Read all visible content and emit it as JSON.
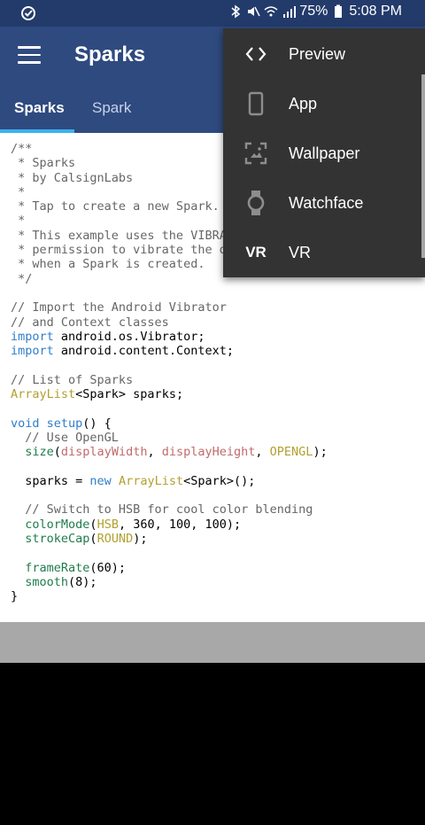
{
  "status_bar": {
    "battery": "75%",
    "time": "5:08 PM"
  },
  "app_bar": {
    "title": "Sparks",
    "tabs": [
      {
        "label": "Sparks",
        "selected": true
      },
      {
        "label": "Spark",
        "selected": false
      }
    ]
  },
  "menu": {
    "items": [
      {
        "label": "Preview",
        "icon": "code-icon"
      },
      {
        "label": "App",
        "icon": "phone-icon"
      },
      {
        "label": "Wallpaper",
        "icon": "wallpaper-icon"
      },
      {
        "label": "Watchface",
        "icon": "watch-icon"
      },
      {
        "label": "VR",
        "icon": "vr-icon",
        "icon_text": "VR"
      }
    ]
  },
  "code": {
    "lines": [
      "/**",
      " * Sparks",
      " * by CalsignLabs",
      " *",
      " * Tap to create a new Spark.",
      " *",
      " * This example uses the VIBRATE",
      " * permission to vibrate the device",
      " * when a Spark is created.",
      " */",
      "",
      "// Import the Android Vibrator",
      "// and Context classes",
      "import android.os.Vibrator;",
      "import android.content.Context;",
      "",
      "// List of Sparks",
      "ArrayList<Spark> sparks;",
      "",
      "void setup() {",
      "  // Use OpenGL",
      "  size(displayWidth, displayHeight, OPENGL);",
      "",
      "  sparks = new ArrayList<Spark>();",
      "",
      "  // Switch to HSB for cool color blending",
      "  colorMode(HSB, 360, 100, 100);",
      "  strokeCap(ROUND);",
      "",
      "  frameRate(60);",
      "  smooth(8);",
      "}"
    ]
  }
}
